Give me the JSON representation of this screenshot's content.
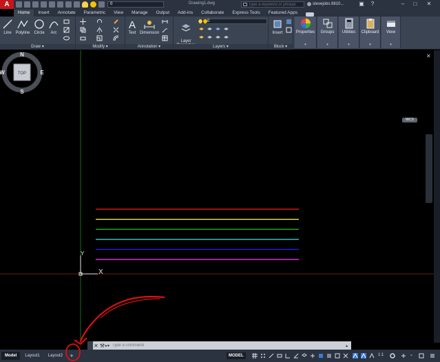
{
  "app": {
    "logo_letter": "A",
    "document_title": "Drawing1.dwg",
    "search_placeholder": "Type a keyword or phrase",
    "user_name": "stevejobs.9810...",
    "quick_access_layer": "0"
  },
  "tabs": [
    {
      "label": "Home",
      "active": true
    },
    {
      "label": "Insert"
    },
    {
      "label": "Annotate"
    },
    {
      "label": "Parametric"
    },
    {
      "label": "View"
    },
    {
      "label": "Manage"
    },
    {
      "label": "Output"
    },
    {
      "label": "Add-ins"
    },
    {
      "label": "Collaborate"
    },
    {
      "label": "Express Tools"
    },
    {
      "label": "Featured Apps"
    }
  ],
  "ribbon": {
    "draw": {
      "title": "Draw",
      "line": "Line",
      "polyline": "Polyline",
      "circle": "Circle",
      "arc": "Arc"
    },
    "modify": {
      "title": "Modify"
    },
    "annotation": {
      "title": "Annotation",
      "text": "Text",
      "dimension": "Dimension"
    },
    "layers": {
      "title": "Layers",
      "layer_properties": "Layer\nProperties",
      "current_layer": "0"
    },
    "block": {
      "title": "Block",
      "insert": "Insert"
    },
    "properties": "Properties",
    "groups": "Groups",
    "utilities": "Utilities",
    "clipboard": "Clipboard",
    "view": "View"
  },
  "viewcube": {
    "n": "N",
    "s": "S",
    "e": "E",
    "w": "W",
    "face": "TOP",
    "wcs": "WCS"
  },
  "ucs": {
    "x": "X",
    "y": "Y"
  },
  "drawing_lines": [
    {
      "color": "#ff2020"
    },
    {
      "color": "#ffff40"
    },
    {
      "color": "#20e020"
    },
    {
      "color": "#40ffff"
    },
    {
      "color": "#2020ff"
    },
    {
      "color": "#ff40ff"
    }
  ],
  "command_line": {
    "placeholder": "Type a command"
  },
  "layouts": [
    {
      "label": "Model",
      "active": true
    },
    {
      "label": "Layout1"
    },
    {
      "label": "Layout2"
    }
  ],
  "add_layout": "+",
  "status": {
    "model": "MODEL",
    "scale": "1:1"
  },
  "colors": {
    "accent_red": "#e01010",
    "ribbon_bg": "#3b4453",
    "titlebar_bg": "#2b3240"
  }
}
